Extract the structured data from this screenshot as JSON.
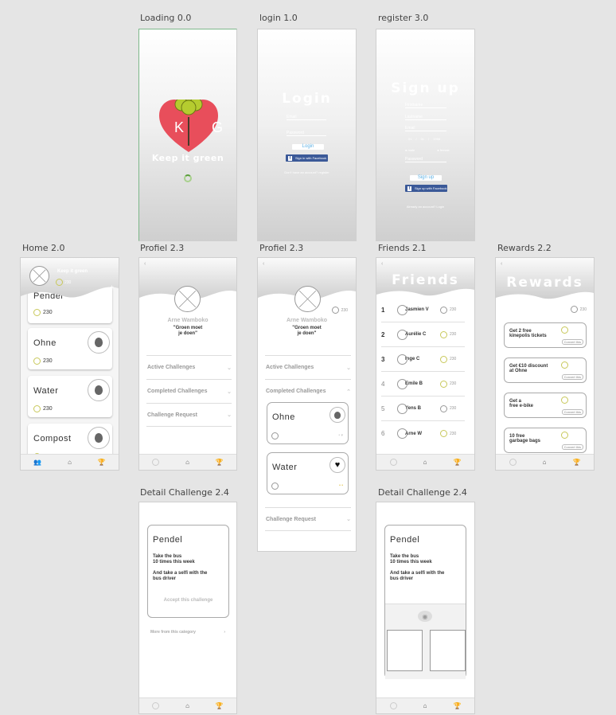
{
  "labels": {
    "loading": "Loading 0.0",
    "login": "login 1.0",
    "register": "register 3.0",
    "home": "Home 2.0",
    "profiel_a": "Profiel 2.3",
    "profiel_b": "Profiel 2.3",
    "friends": "Friends 2.1",
    "rewards": "Rewards 2.2",
    "detail_a": "Detail Challenge 2.4",
    "detail_b": "Detail Challenge 2.4"
  },
  "colors": {
    "brand_red": "#e84e5b",
    "tree_green": "#b5cc2f",
    "facebook": "#3b5998",
    "login_blue": "#5db1e5",
    "coin": "#c8c85a"
  },
  "loading": {
    "logo_letters": "K G",
    "tagline": "Keep it green"
  },
  "login": {
    "title": "Login",
    "email_label": "Email",
    "password_label": "Password",
    "login_button": "Login",
    "facebook_button": "Sign in with Facebook",
    "register_text": "Don't have an account? register"
  },
  "register": {
    "title": "Sign up",
    "firstname_label": "Firstname",
    "lastname_label": "Lastname",
    "email_label": "Email",
    "dob_day": "01",
    "dob_month": "01",
    "dob_year": "1998",
    "dob_separator": "/",
    "gender_male": "male",
    "gender_female": "female",
    "password_label": "Password",
    "signup_button": "Sign up",
    "facebook_button": "Sign up with Facebook",
    "login_text": "Already an account? Login"
  },
  "home": {
    "header_title": "Keep it green",
    "header_points": "230",
    "cards": [
      {
        "title": "Pendel",
        "points": "230"
      },
      {
        "title": "Ohne",
        "points": "230"
      },
      {
        "title": "Water",
        "points": "230"
      },
      {
        "title": "Compost",
        "points": ""
      }
    ]
  },
  "profile": {
    "name": "Arne Wamboko",
    "quote_line1": "\"Groen moet",
    "quote_line2": "je doen\"",
    "points": "230",
    "sections": {
      "active": "Active Challenges",
      "completed": "Completed Challenges",
      "request": "Challenge Request"
    },
    "completed_cards": [
      {
        "title": "Ohne"
      },
      {
        "title": "Water"
      }
    ]
  },
  "friends": {
    "title": "Friends",
    "rows": [
      {
        "rank": "1",
        "name": "Jasmien V",
        "points": "230"
      },
      {
        "rank": "2",
        "name": "Aurélie C",
        "points": "230"
      },
      {
        "rank": "3",
        "name": "Inge C",
        "points": "230"
      },
      {
        "rank": "4",
        "name": "Emile B",
        "points": "230"
      },
      {
        "rank": "5",
        "name": "Yens B",
        "points": "230"
      },
      {
        "rank": "6",
        "name": "Arne W",
        "points": "230"
      }
    ]
  },
  "rewards": {
    "title": "Rewards",
    "points": "230",
    "items": [
      {
        "line1": "Get 2 free",
        "line2": "kinepolis tickets",
        "button": "Convert this"
      },
      {
        "line1": "Get €10 discount",
        "line2": "at Ohne",
        "button": "Convert this"
      },
      {
        "line1": "Get a",
        "line2": "free e-bike",
        "button": "Convert this"
      },
      {
        "line1": "10 free",
        "line2": "garbage bags",
        "button": "Convert this"
      }
    ]
  },
  "detail": {
    "title": "Pendel",
    "desc1_line1": "Take the bus",
    "desc1_line2": "10 times this week",
    "desc2_line1": "And take a selfi with the",
    "desc2_line2": "bus driver",
    "accept_button": "Accept this challenge",
    "more_link": "More from this category"
  },
  "nav": {
    "friends_icon": "people-icon",
    "home_icon": "home-icon",
    "rewards_icon": "trophy-icon"
  }
}
